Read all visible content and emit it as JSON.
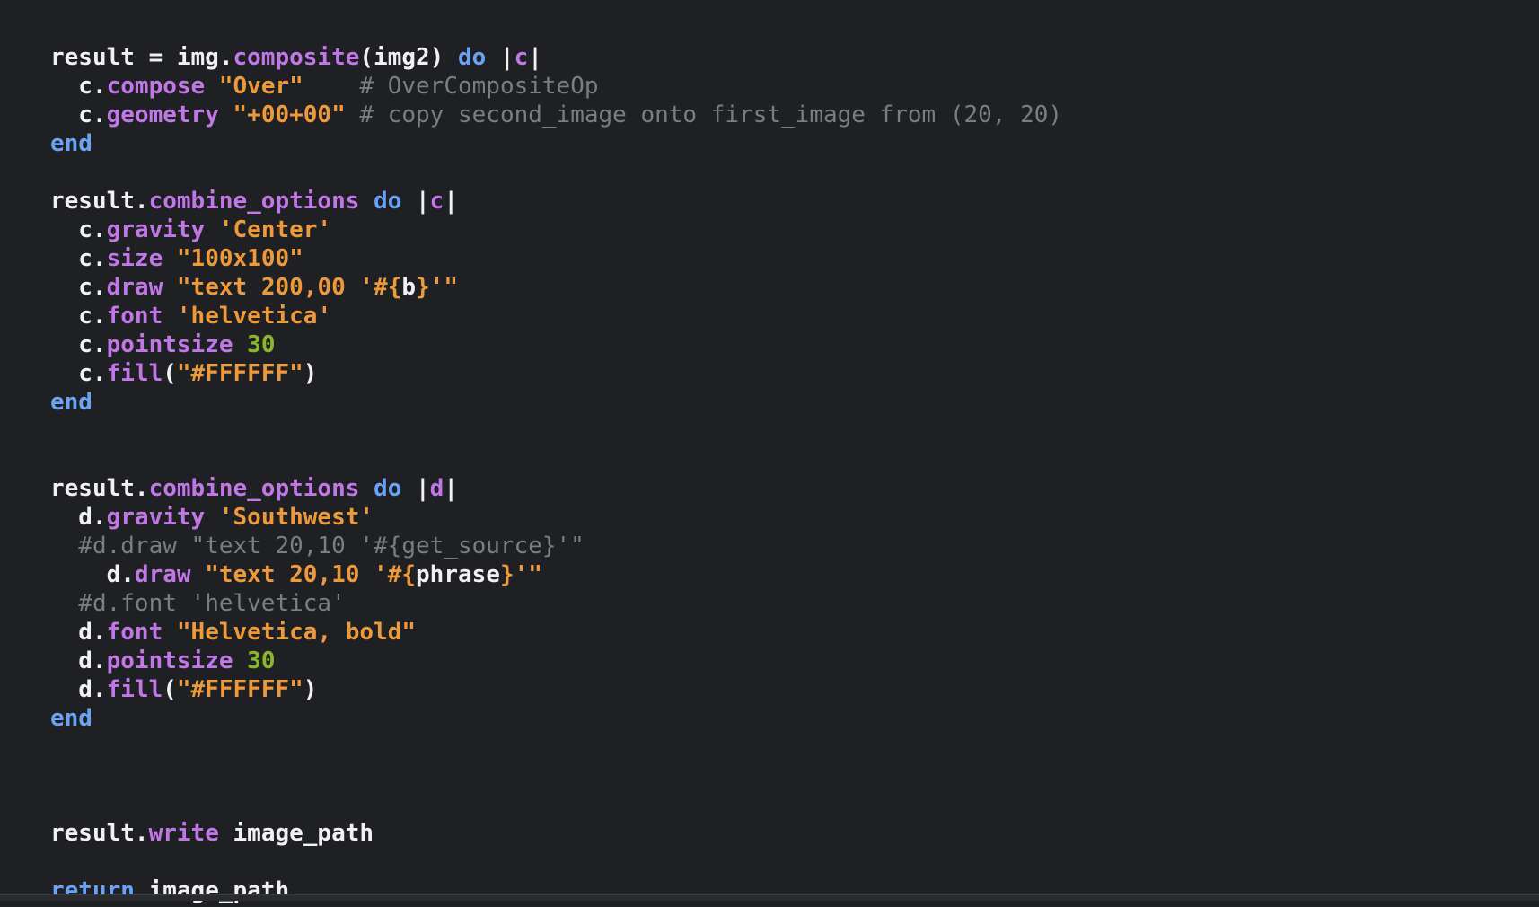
{
  "editor": {
    "language": "ruby",
    "colors": {
      "background": "#1f2023",
      "plain": "#f1f1f1",
      "keyword": "#6aa3f5",
      "method": "#c178e6",
      "string": "#ec9a3c",
      "number": "#8bb52b",
      "comment": "#7b7d82"
    },
    "lines": [
      {
        "tokens": [
          {
            "t": "plain",
            "v": "result = img."
          },
          {
            "t": "method",
            "v": "composite"
          },
          {
            "t": "plain",
            "v": "(img2) "
          },
          {
            "t": "keyword",
            "v": "do"
          },
          {
            "t": "plain",
            "v": " |"
          },
          {
            "t": "param",
            "v": "c"
          },
          {
            "t": "plain",
            "v": "|"
          }
        ]
      },
      {
        "tokens": [
          {
            "t": "plain",
            "v": "  c."
          },
          {
            "t": "method",
            "v": "compose"
          },
          {
            "t": "plain",
            "v": " "
          },
          {
            "t": "string",
            "v": "\"Over\""
          },
          {
            "t": "plain",
            "v": "    "
          },
          {
            "t": "comment",
            "v": "# OverCompositeOp"
          }
        ]
      },
      {
        "tokens": [
          {
            "t": "plain",
            "v": "  c."
          },
          {
            "t": "method",
            "v": "geometry"
          },
          {
            "t": "plain",
            "v": " "
          },
          {
            "t": "string",
            "v": "\"+00+00\""
          },
          {
            "t": "plain",
            "v": " "
          },
          {
            "t": "comment",
            "v": "# copy second_image onto first_image from (20, 20)"
          }
        ]
      },
      {
        "tokens": [
          {
            "t": "keyword",
            "v": "end"
          }
        ]
      },
      {
        "tokens": []
      },
      {
        "tokens": [
          {
            "t": "plain",
            "v": "result."
          },
          {
            "t": "method",
            "v": "combine_options"
          },
          {
            "t": "plain",
            "v": " "
          },
          {
            "t": "keyword",
            "v": "do"
          },
          {
            "t": "plain",
            "v": " |"
          },
          {
            "t": "param",
            "v": "c"
          },
          {
            "t": "plain",
            "v": "|"
          }
        ]
      },
      {
        "tokens": [
          {
            "t": "plain",
            "v": "  c."
          },
          {
            "t": "method",
            "v": "gravity"
          },
          {
            "t": "plain",
            "v": " "
          },
          {
            "t": "string",
            "v": "'Center'"
          }
        ]
      },
      {
        "tokens": [
          {
            "t": "plain",
            "v": "  c."
          },
          {
            "t": "method",
            "v": "size"
          },
          {
            "t": "plain",
            "v": " "
          },
          {
            "t": "string",
            "v": "\"100x100\""
          }
        ]
      },
      {
        "tokens": [
          {
            "t": "plain",
            "v": "  c."
          },
          {
            "t": "method",
            "v": "draw"
          },
          {
            "t": "plain",
            "v": " "
          },
          {
            "t": "string",
            "v": "\"text 200,00 '#{"
          },
          {
            "t": "interp",
            "v": "b"
          },
          {
            "t": "string",
            "v": "}'\""
          }
        ]
      },
      {
        "tokens": [
          {
            "t": "plain",
            "v": "  c."
          },
          {
            "t": "method",
            "v": "font"
          },
          {
            "t": "plain",
            "v": " "
          },
          {
            "t": "string",
            "v": "'helvetica'"
          }
        ]
      },
      {
        "tokens": [
          {
            "t": "plain",
            "v": "  c."
          },
          {
            "t": "method",
            "v": "pointsize"
          },
          {
            "t": "plain",
            "v": " "
          },
          {
            "t": "number",
            "v": "30"
          }
        ]
      },
      {
        "tokens": [
          {
            "t": "plain",
            "v": "  c."
          },
          {
            "t": "method",
            "v": "fill"
          },
          {
            "t": "plain",
            "v": "("
          },
          {
            "t": "string",
            "v": "\"#FFFFFF\""
          },
          {
            "t": "plain",
            "v": ")"
          }
        ]
      },
      {
        "tokens": [
          {
            "t": "keyword",
            "v": "end"
          }
        ]
      },
      {
        "tokens": []
      },
      {
        "tokens": []
      },
      {
        "tokens": [
          {
            "t": "plain",
            "v": "result."
          },
          {
            "t": "method",
            "v": "combine_options"
          },
          {
            "t": "plain",
            "v": " "
          },
          {
            "t": "keyword",
            "v": "do"
          },
          {
            "t": "plain",
            "v": " |"
          },
          {
            "t": "param",
            "v": "d"
          },
          {
            "t": "plain",
            "v": "|"
          }
        ]
      },
      {
        "tokens": [
          {
            "t": "plain",
            "v": "  d."
          },
          {
            "t": "method",
            "v": "gravity"
          },
          {
            "t": "plain",
            "v": " "
          },
          {
            "t": "string",
            "v": "'Southwest'"
          }
        ]
      },
      {
        "tokens": [
          {
            "t": "plain",
            "v": "  "
          },
          {
            "t": "comment",
            "v": "#d.draw \"text 20,10 '#{get_source}'\""
          }
        ]
      },
      {
        "tokens": [
          {
            "t": "plain",
            "v": "    d."
          },
          {
            "t": "method",
            "v": "draw"
          },
          {
            "t": "plain",
            "v": " "
          },
          {
            "t": "string",
            "v": "\"text 20,10 '#{"
          },
          {
            "t": "interp",
            "v": "phrase"
          },
          {
            "t": "string",
            "v": "}'\""
          }
        ]
      },
      {
        "tokens": [
          {
            "t": "plain",
            "v": "  "
          },
          {
            "t": "comment",
            "v": "#d.font 'helvetica'"
          }
        ]
      },
      {
        "tokens": [
          {
            "t": "plain",
            "v": "  d."
          },
          {
            "t": "method",
            "v": "font"
          },
          {
            "t": "plain",
            "v": " "
          },
          {
            "t": "string",
            "v": "\"Helvetica, bold\""
          }
        ]
      },
      {
        "tokens": [
          {
            "t": "plain",
            "v": "  d."
          },
          {
            "t": "method",
            "v": "pointsize"
          },
          {
            "t": "plain",
            "v": " "
          },
          {
            "t": "number",
            "v": "30"
          }
        ]
      },
      {
        "tokens": [
          {
            "t": "plain",
            "v": "  d."
          },
          {
            "t": "method",
            "v": "fill"
          },
          {
            "t": "plain",
            "v": "("
          },
          {
            "t": "string",
            "v": "\"#FFFFFF\""
          },
          {
            "t": "plain",
            "v": ")"
          }
        ]
      },
      {
        "tokens": [
          {
            "t": "keyword",
            "v": "end"
          }
        ]
      },
      {
        "tokens": []
      },
      {
        "tokens": []
      },
      {
        "tokens": []
      },
      {
        "tokens": [
          {
            "t": "plain",
            "v": "result."
          },
          {
            "t": "method",
            "v": "write"
          },
          {
            "t": "plain",
            "v": " image_path"
          }
        ]
      },
      {
        "tokens": []
      },
      {
        "tokens": [
          {
            "t": "keyword",
            "v": "return"
          },
          {
            "t": "plain",
            "v": " image_path"
          }
        ]
      }
    ]
  }
}
